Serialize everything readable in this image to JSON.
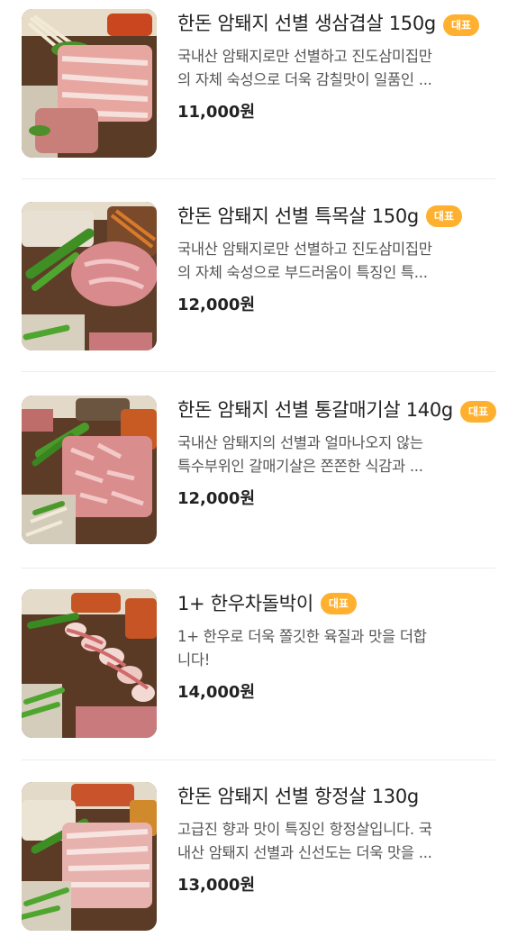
{
  "menu_items": [
    {
      "title": "한돈 암퇘지 선별 생삼겹살 150g",
      "badge": "대표",
      "desc_line1": "국내산 암퇘지로만 선별하고 진도삼미집만",
      "desc_line2": "의 자체 숙성으로 더욱 감칠맛이 일품인 ...",
      "price": "11,000원"
    },
    {
      "title": "한돈 암퇘지 선별 특목살 150g",
      "badge": "대표",
      "desc_line1": "국내산 암퇘지로만 선별하고 진도삼미집만",
      "desc_line2": "의 자체 숙성으로 부드러움이 특징인 특...",
      "price": "12,000원"
    },
    {
      "title": "한돈 암퇘지 선별 통갈매기살 140g",
      "badge": "대표",
      "desc_line1": "국내산 암퇘지의 선별과 얼마나오지 않는",
      "desc_line2": "특수부위인 갈매기살은 쫀쫀한 식감과 ...",
      "price": "12,000원"
    },
    {
      "title": "1+ 한우차돌박이",
      "badge": "대표",
      "desc_line1": "1+ 한우로 더욱 쫄깃한 육질과 맛을 더합",
      "desc_line2": "니다!",
      "price": "14,000원"
    },
    {
      "title": "한돈 암퇘지 선별 항정살 130g",
      "badge": "",
      "desc_line1": "고급진 향과 맛이 특징인 항정살입니다. 국",
      "desc_line2": "내산 암퇘지 선별과 신선도는 더욱 맛을 ...",
      "price": "13,000원"
    }
  ],
  "colors": {
    "badge": "#ffb02e",
    "divider": "#ececec",
    "price_text": "#222222"
  }
}
